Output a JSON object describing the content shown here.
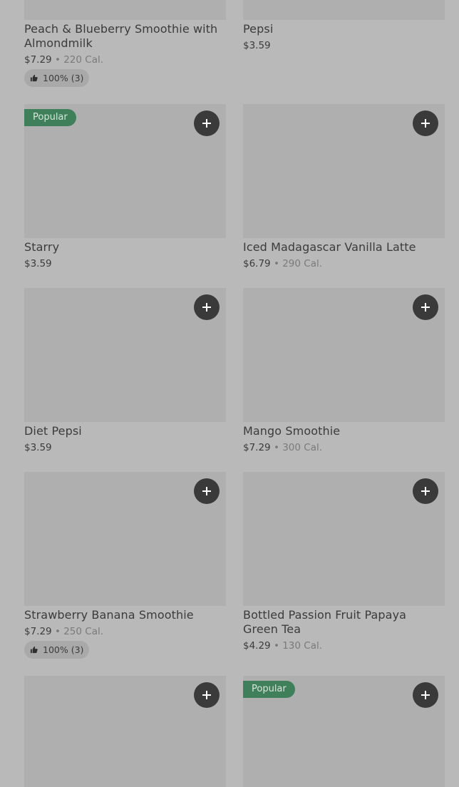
{
  "items": [
    {
      "name": "Peach & Blueberry Smoothie with Almondmilk",
      "price": "$7.29",
      "separator": "•",
      "calories": "220 Cal.",
      "rating": "100% (3)"
    },
    {
      "name": "Pepsi",
      "price": "$3.59"
    },
    {
      "name": "Starry",
      "price": "$3.59",
      "badge": "Popular"
    },
    {
      "name": "Iced Madagascar Vanilla Latte",
      "price": "$6.79",
      "separator": "•",
      "calories": "290 Cal."
    },
    {
      "name": "Diet Pepsi",
      "price": "$3.59"
    },
    {
      "name": "Mango Smoothie",
      "price": "$7.29",
      "separator": "•",
      "calories": "300 Cal."
    },
    {
      "name": "Strawberry Banana Smoothie",
      "price": "$7.29",
      "separator": "•",
      "calories": "250 Cal.",
      "rating": "100% (3)"
    },
    {
      "name": "Bottled Passion Fruit Papaya Green Tea",
      "price": "$4.29",
      "separator": "•",
      "calories": "130 Cal."
    },
    {},
    {
      "badge": "Popular"
    }
  ],
  "icons": {
    "add": "plus-icon",
    "thumbs_up": "thumbs-up-icon"
  },
  "colors": {
    "background": "#b9b9b9",
    "image_placeholder": "#afafaf",
    "add_button": "#3a3a3a",
    "popular_badge": "#3f7f5a"
  }
}
